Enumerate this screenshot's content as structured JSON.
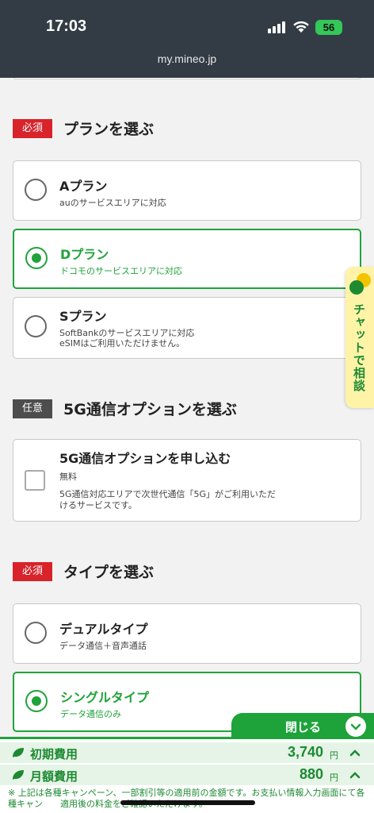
{
  "status": {
    "time": "17:03",
    "battery": "56",
    "url": "my.mineo.jp"
  },
  "plan_section": {
    "badge": "必須",
    "title": "プランを選ぶ",
    "options": [
      {
        "title": "Aプラン",
        "sub": "auのサービスエリアに対応",
        "selected": false
      },
      {
        "title": "Dプラン",
        "sub": "ドコモのサービスエリアに対応",
        "selected": true
      },
      {
        "title": "Sプラン",
        "sub1": "SoftBankのサービスエリアに対応",
        "sub2": "eSIMはご利用いただけません。",
        "selected": false
      }
    ]
  },
  "option_section": {
    "badge": "任意",
    "title": "5G通信オプションを選ぶ",
    "option": {
      "title": "5G通信オプションを申し込む",
      "price": "無料",
      "desc1": "5G通信対応エリアで次世代通信「5G」がご利用いただ",
      "desc2": "けるサービスです。",
      "checked": false
    }
  },
  "type_section": {
    "badge": "必須",
    "title": "タイプを選ぶ",
    "options": [
      {
        "title": "デュアルタイプ",
        "sub": "データ通信＋音声通話",
        "selected": false
      },
      {
        "title": "シングルタイプ",
        "sub": "データ通信のみ",
        "selected": true
      }
    ]
  },
  "chat": {
    "label": "チャットで相談",
    "icon_letters": "A Q"
  },
  "fees": {
    "close_label": "閉じる",
    "initial": {
      "name": "初期費用",
      "amount": "3,740",
      "unit": "円"
    },
    "monthly": {
      "name": "月額費用",
      "amount": "880",
      "unit": "円"
    },
    "note": "※ 上記は各種キャンペーン、一部割引等の適用前の金額です。お支払い情報入力画面にて各種キャン　　適用後の料金をご確認いただけます。"
  },
  "colors": {
    "green": "#20a33a",
    "required_red": "#d8232a",
    "optional_gray": "#4d4d4d",
    "header": "#333c45"
  }
}
